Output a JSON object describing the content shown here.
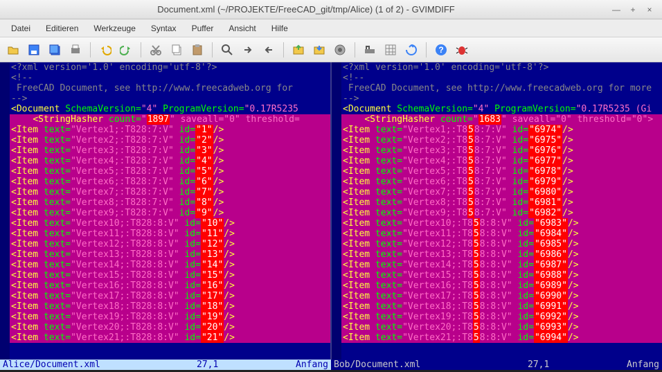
{
  "window": {
    "title": "Document.xml (~/PROJEKTE/FreeCAD_git/tmp/Alice) (1 of 2) - GVIMDIFF"
  },
  "menu": {
    "items": [
      "Datei",
      "Editieren",
      "Werkzeuge",
      "Syntax",
      "Puffer",
      "Ansicht",
      "Hilfe"
    ]
  },
  "toolbar": {
    "icons": [
      "open",
      "save",
      "save-all",
      "print",
      "undo",
      "redo",
      "cut",
      "copy",
      "paste",
      "find",
      "next",
      "prev",
      "fc1",
      "fc2",
      "fc3",
      "fc4",
      "fc5",
      "fc6",
      "help",
      "bug"
    ]
  },
  "common": {
    "line1": "<?xml version='1.0' encoding='utf-8'?>",
    "line2": "<!--",
    "line3_left": " FreeCAD Document, see http://www.freecadweb.org for ",
    "line3_right": " FreeCAD Document, see http://www.freecadweb.org for more",
    "line4": "-->",
    "doc_left": "<Document SchemaVersion=\"4\" ProgramVersion=\"0.17R5235",
    "doc_right": "<Document SchemaVersion=\"4\" ProgramVersion=\"0.17R5235 (Gi",
    "sh_prefix": "    <StringHasher count=\"",
    "sh_left_count": "1897",
    "sh_right_count": "1683",
    "sh_left_rest": "\" saveall=\"0\" threshold=",
    "sh_right_rest": "\" saveall=\"0\" threshold=\"0\">"
  },
  "left": {
    "vtype_small": "T828:7:V",
    "vtype_big": "T828:8:V",
    "items": [
      {
        "n": "1",
        "id": "1",
        "t": "small"
      },
      {
        "n": "2",
        "id": "2",
        "t": "small"
      },
      {
        "n": "3",
        "id": "3",
        "t": "small"
      },
      {
        "n": "4",
        "id": "4",
        "t": "small"
      },
      {
        "n": "5",
        "id": "5",
        "t": "small"
      },
      {
        "n": "6",
        "id": "6",
        "t": "small"
      },
      {
        "n": "7",
        "id": "7",
        "t": "small"
      },
      {
        "n": "8",
        "id": "8",
        "t": "small"
      },
      {
        "n": "9",
        "id": "9",
        "t": "small"
      },
      {
        "n": "10",
        "id": "10",
        "t": "big"
      },
      {
        "n": "11",
        "id": "11",
        "t": "big"
      },
      {
        "n": "12",
        "id": "12",
        "t": "big"
      },
      {
        "n": "13",
        "id": "13",
        "t": "big"
      },
      {
        "n": "14",
        "id": "14",
        "t": "big"
      },
      {
        "n": "15",
        "id": "15",
        "t": "big"
      },
      {
        "n": "16",
        "id": "16",
        "t": "big"
      },
      {
        "n": "17",
        "id": "17",
        "t": "big"
      },
      {
        "n": "18",
        "id": "18",
        "t": "big"
      },
      {
        "n": "19",
        "id": "19",
        "t": "big"
      },
      {
        "n": "20",
        "id": "20",
        "t": "big"
      },
      {
        "n": "21",
        "id": "21",
        "t": "big"
      }
    ]
  },
  "right": {
    "vtype_small": "T858:7:V",
    "vtype_big": "T858:8:V",
    "items": [
      {
        "n": "1",
        "id": "6974",
        "t": "small"
      },
      {
        "n": "2",
        "id": "6975",
        "t": "small"
      },
      {
        "n": "3",
        "id": "6976",
        "t": "small"
      },
      {
        "n": "4",
        "id": "6977",
        "t": "small"
      },
      {
        "n": "5",
        "id": "6978",
        "t": "small"
      },
      {
        "n": "6",
        "id": "6979",
        "t": "small"
      },
      {
        "n": "7",
        "id": "6980",
        "t": "small"
      },
      {
        "n": "8",
        "id": "6981",
        "t": "small"
      },
      {
        "n": "9",
        "id": "6982",
        "t": "small"
      },
      {
        "n": "10",
        "id": "6983",
        "t": "big"
      },
      {
        "n": "11",
        "id": "6984",
        "t": "big"
      },
      {
        "n": "12",
        "id": "6985",
        "t": "big"
      },
      {
        "n": "13",
        "id": "6986",
        "t": "big"
      },
      {
        "n": "14",
        "id": "6987",
        "t": "big"
      },
      {
        "n": "15",
        "id": "6988",
        "t": "big"
      },
      {
        "n": "16",
        "id": "6989",
        "t": "big"
      },
      {
        "n": "17",
        "id": "6990",
        "t": "big"
      },
      {
        "n": "18",
        "id": "6991",
        "t": "big"
      },
      {
        "n": "19",
        "id": "6992",
        "t": "big"
      },
      {
        "n": "20",
        "id": "6993",
        "t": "big"
      },
      {
        "n": "21",
        "id": "6994",
        "t": "big"
      }
    ]
  },
  "status": {
    "left": {
      "file": "Alice/Document.xml",
      "pos": "27,1",
      "pct": "Anfang"
    },
    "right": {
      "file": "Bob/Document.xml",
      "pos": "27,1",
      "pct": "Anfang"
    }
  }
}
